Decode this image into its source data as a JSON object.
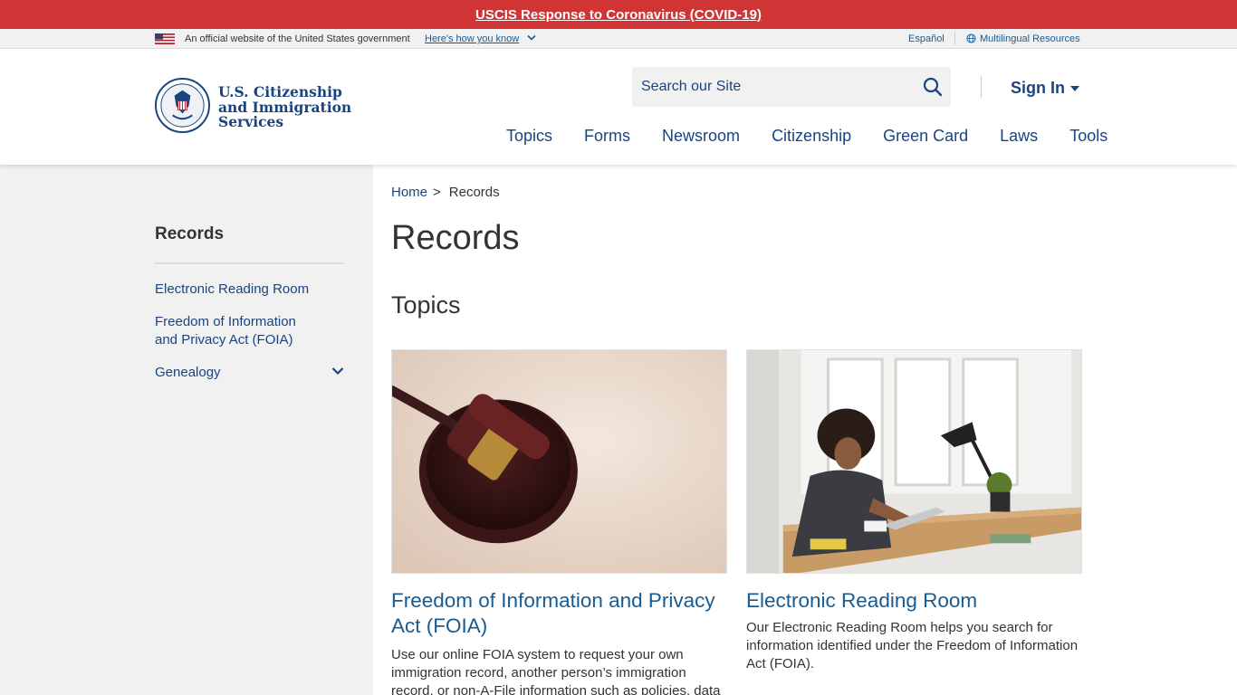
{
  "alert": {
    "link": "USCIS Response to Coronavirus (COVID-19)"
  },
  "gov_banner": {
    "official": "An official website of the United States government",
    "how_you_know": "Here's how you know",
    "espanol": "Español",
    "multilingual": "Multilingual Resources"
  },
  "header": {
    "logo_lines": [
      "U.S. Citizenship",
      "and Immigration",
      "Services"
    ],
    "search_placeholder": "Search our Site",
    "sign_in": "Sign In",
    "nav": [
      "Topics",
      "Forms",
      "Newsroom",
      "Citizenship",
      "Green Card",
      "Laws",
      "Tools"
    ]
  },
  "sidebar": {
    "title": "Records",
    "items": [
      "Electronic Reading Room",
      "Freedom of Information and Privacy Act (FOIA)",
      "Genealogy"
    ]
  },
  "breadcrumb": {
    "home": "Home",
    "separator": ">",
    "current": "Records"
  },
  "page_title": "Records",
  "section_title": "Topics",
  "cards": [
    {
      "title": "Freedom of Information and Privacy Act (FOIA)",
      "description": "Use our online FOIA system to request your own immigration record, another person’s immigration record, or non-A-File information such as policies, data"
    },
    {
      "title": "Electronic Reading Room",
      "description": "Our Electronic Reading Room helps you search for information identified under the Freedom of Information Act (FOIA)."
    }
  ],
  "colors": {
    "alert_red": "#d03434",
    "brand_blue": "#1a4480",
    "link_blue": "#1a5b8f",
    "sidebar_bg": "#f1f1f1"
  }
}
